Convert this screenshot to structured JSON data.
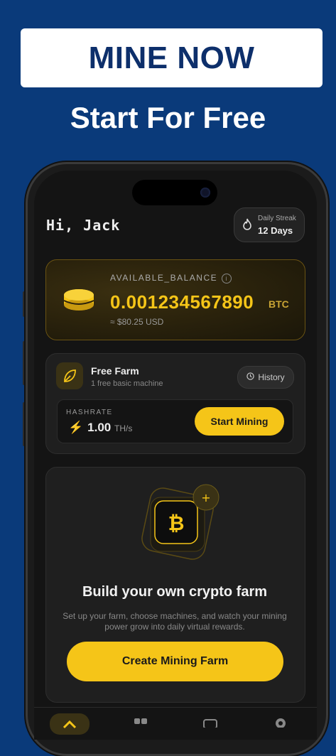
{
  "banner": {
    "title": "MINE NOW",
    "subtitle": "Start For Free"
  },
  "header": {
    "greeting": "Hi, Jack",
    "streak_label": "Daily Streak",
    "streak_value": "12 Days"
  },
  "balance": {
    "label": "AVAILABLE_BALANCE",
    "value": "0.001234567890",
    "unit": "BTC",
    "usd": "≈ $80.25 USD"
  },
  "farm": {
    "title": "Free Farm",
    "subtitle": "1 free basic machine",
    "history_label": "History",
    "hashrate_label": "HASHRATE",
    "hashrate_value": "1.00",
    "hashrate_unit": "TH/s",
    "start_label": "Start Mining"
  },
  "build": {
    "title": "Build your own crypto farm",
    "description": "Set up your farm, choose machines, and watch your mining power grow into daily virtual rewards.",
    "cta_label": "Create Mining Farm",
    "icon_glyph": "₿"
  },
  "colors": {
    "accent": "#f5c518",
    "background": "#0a3a7a",
    "banner_text": "#0d2f6b"
  },
  "tabbar": {
    "icons": [
      "home-icon",
      "grid-icon",
      "wallet-icon",
      "settings-icon"
    ]
  }
}
